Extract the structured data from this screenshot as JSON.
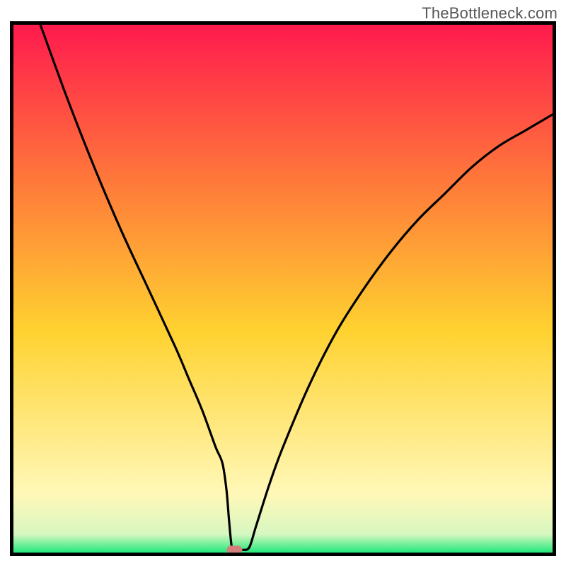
{
  "watermark": "TheBottleneck.com",
  "chart_data": {
    "type": "line",
    "title": "",
    "xlabel": "",
    "ylabel": "",
    "xlim": [
      0,
      100
    ],
    "ylim": [
      0,
      100
    ],
    "x": [
      5,
      10,
      15,
      20,
      25,
      30,
      32.5,
      35,
      37.5,
      38.75,
      39.5,
      40,
      40.5,
      41,
      42,
      42.5,
      43.75,
      45,
      47.5,
      50,
      55,
      60,
      65,
      70,
      75,
      80,
      85,
      90,
      95,
      100
    ],
    "values": [
      100,
      86,
      73,
      61,
      50,
      39,
      33,
      27,
      20,
      17,
      12,
      6,
      1,
      0.5,
      0.5,
      0.5,
      1,
      5,
      13,
      20,
      32,
      42,
      50,
      57,
      63,
      68,
      73,
      77,
      80,
      83
    ],
    "legend": false,
    "background_gradient": {
      "top": "#ff1a4d",
      "mid_upper": "#ff7a3a",
      "mid": "#ffd230",
      "lower": "#fff8b8",
      "bottom": "#22e87a"
    },
    "marker": {
      "x": 41,
      "y": 0.5,
      "color": "#d47e7e"
    }
  }
}
